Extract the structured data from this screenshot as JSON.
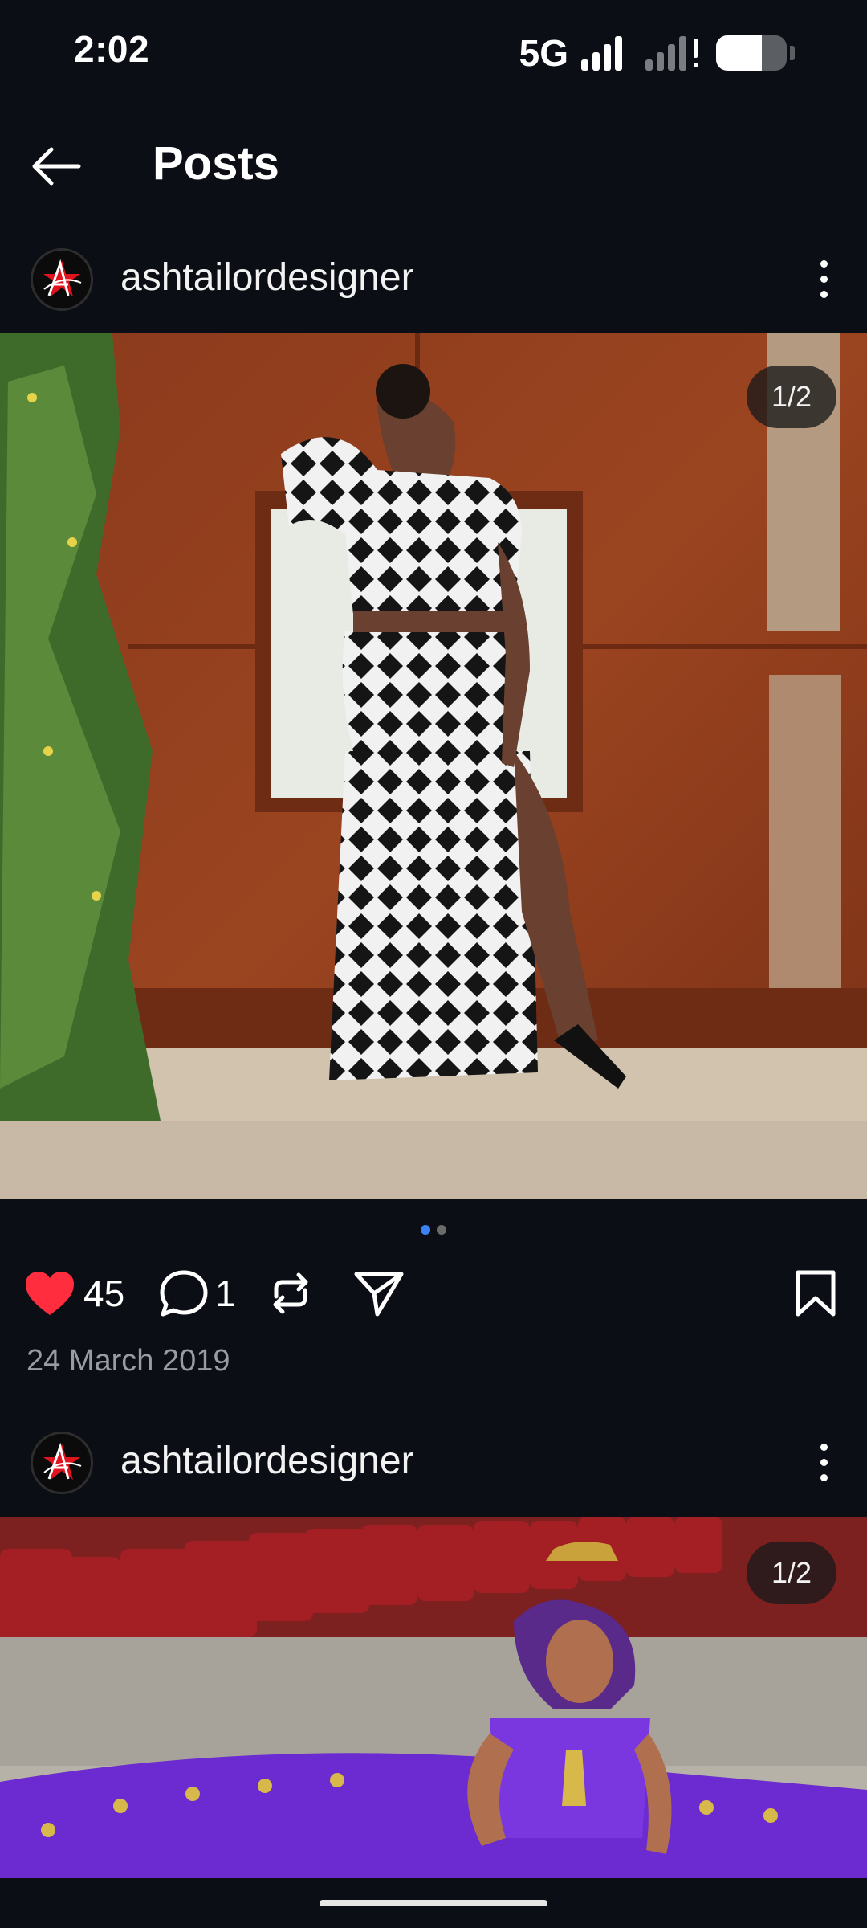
{
  "status_bar": {
    "time": "2:02",
    "network": "5G",
    "battery_level": 0.65
  },
  "app_bar": {
    "title": "Posts"
  },
  "posts": [
    {
      "username": "ashtailordesigner",
      "page_indicator": "1/2",
      "likes": "45",
      "comments": "1",
      "date": "24 March 2019"
    },
    {
      "username": "ashtailordesigner",
      "page_indicator": "1/2"
    }
  ],
  "colors": {
    "background": "#0b0e14",
    "like_red": "#ff2d3d",
    "active_dot": "#3b82f6"
  }
}
